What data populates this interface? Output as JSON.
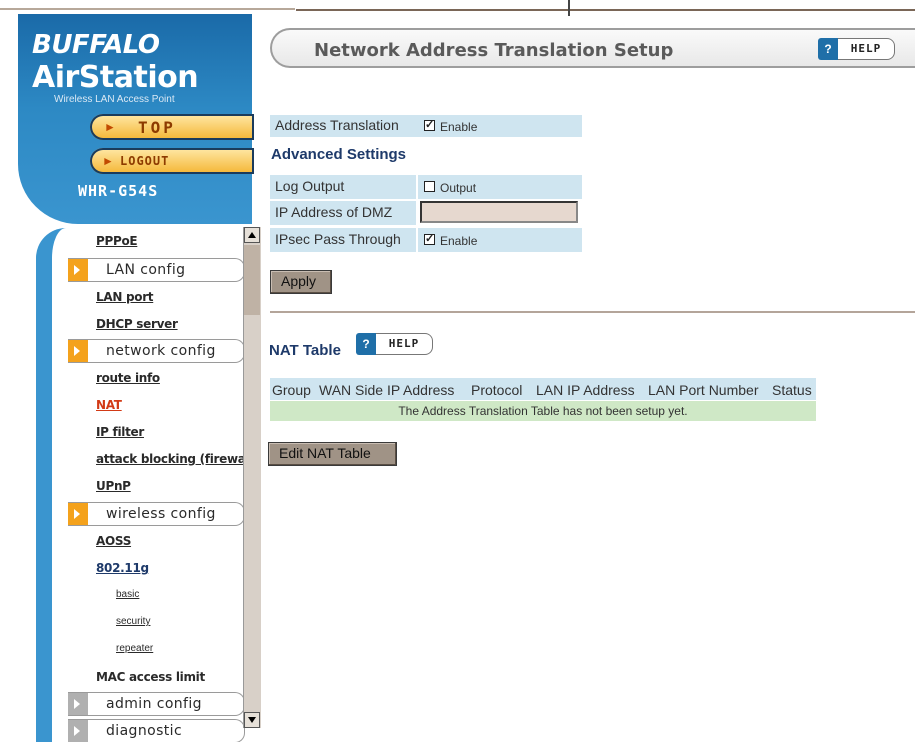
{
  "sidebar": {
    "brand": "BUFFALO",
    "product": "AirStation",
    "tagline": "Wireless LAN Access Point",
    "top_label": "TOP",
    "logout_label": "LOGOUT",
    "model": "WHR-G54S",
    "items": [
      {
        "label": "PPPoE"
      },
      {
        "group": "LAN config"
      },
      {
        "label": "LAN port"
      },
      {
        "label": "DHCP server"
      },
      {
        "group": "network config"
      },
      {
        "label": "route info"
      },
      {
        "label": "NAT"
      },
      {
        "label": "IP filter"
      },
      {
        "label": "attack blocking (firewall)"
      },
      {
        "label": "UPnP"
      },
      {
        "group": "wireless config"
      },
      {
        "label": "AOSS"
      },
      {
        "label": "802.11g"
      },
      {
        "label": "basic"
      },
      {
        "label": "security"
      },
      {
        "label": "repeater"
      },
      {
        "label": "MAC access limit"
      },
      {
        "group": "admin config"
      },
      {
        "group": "diagnostic"
      }
    ]
  },
  "main": {
    "title": "Network Address Translation Setup",
    "help_label": "HELP",
    "help_q": "?",
    "address_translation": {
      "label": "Address Translation",
      "checked": true,
      "check_label": "Enable"
    },
    "advanced_heading": "Advanced Settings",
    "log_output": {
      "label": "Log Output",
      "checked": false,
      "check_label": "Output"
    },
    "dmz": {
      "label": "IP Address of DMZ",
      "value": ""
    },
    "ipsec": {
      "label": "IPsec Pass Through",
      "checked": true,
      "check_label": "Enable"
    },
    "apply_label": "Apply",
    "nat_table_heading": "NAT Table",
    "nat_columns": [
      "Group",
      "WAN Side IP Address",
      "Protocol",
      "LAN IP Address",
      "LAN Port Number",
      "Status"
    ],
    "nat_empty_message": "The Address Translation Table has not been setup yet.",
    "edit_nat_label": "Edit NAT Table"
  },
  "colors": {
    "accent": "#1f6fa8",
    "nav_active": "#d23a16",
    "row_bg": "#cfe5f0",
    "empty_row_bg": "#cfe8c6"
  }
}
